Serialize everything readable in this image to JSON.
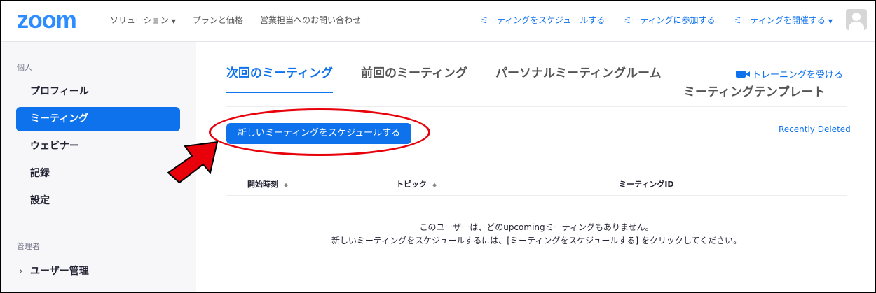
{
  "header": {
    "logo": "zoom",
    "nav_left": [
      {
        "label": "ソリューション",
        "caret": true
      },
      {
        "label": "プランと価格",
        "caret": false
      },
      {
        "label": "営業担当へのお問い合わせ",
        "caret": false
      }
    ],
    "nav_right": [
      {
        "label": "ミーティングをスケジュールする",
        "caret": false
      },
      {
        "label": "ミーティングに参加する",
        "caret": false
      },
      {
        "label": "ミーティングを開催する",
        "caret": true
      }
    ]
  },
  "sidebar": {
    "personal_label": "個人",
    "items": [
      {
        "label": "プロフィール",
        "active": false
      },
      {
        "label": "ミーティング",
        "active": true
      },
      {
        "label": "ウェビナー",
        "active": false
      },
      {
        "label": "記録",
        "active": false
      },
      {
        "label": "設定",
        "active": false
      }
    ],
    "admin_label": "管理者",
    "admin_items": [
      {
        "label": "ユーザー管理"
      }
    ]
  },
  "main": {
    "tabs": [
      {
        "label": "次回のミーティング",
        "active": true
      },
      {
        "label": "前回のミーティング",
        "active": false
      },
      {
        "label": "パーソナルミーティングルーム",
        "active": false
      }
    ],
    "training_link": "トレーニングを受ける",
    "template_tab": "ミーティングテンプレート",
    "schedule_button": "新しいミーティングをスケジュールする",
    "recently_deleted": "Recently Deleted",
    "columns": [
      "開始時刻",
      "トピック",
      "ミーティングID"
    ],
    "empty_line1": "このユーザーは、どのupcomingミーティングもありません。",
    "empty_line2": "新しいミーティングをスケジュールするには、[ミーティングをスケジュールする] をクリックしてください。"
  },
  "colors": {
    "accent": "#0e72ed",
    "logo": "#2d8cff",
    "annotation": "#e8000b"
  }
}
